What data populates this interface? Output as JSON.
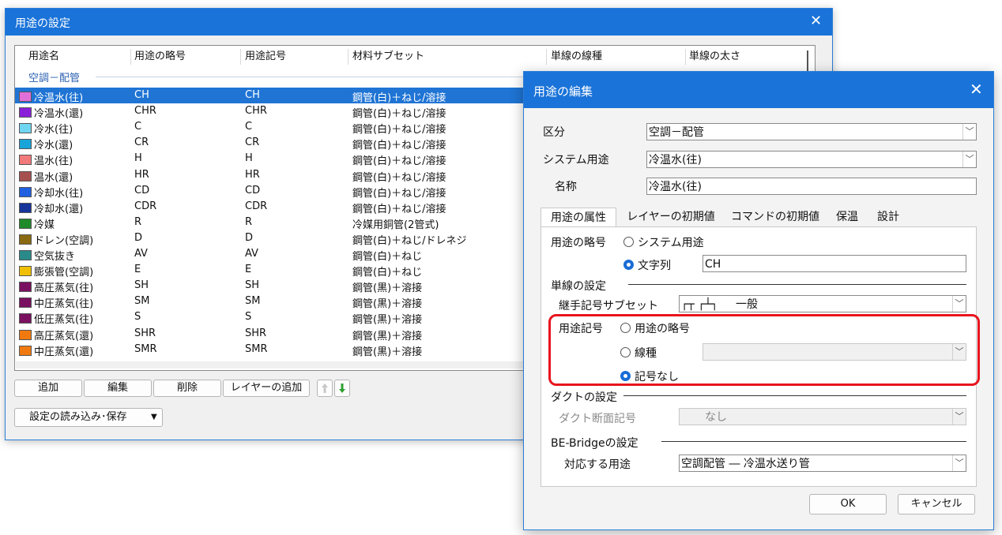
{
  "main_window": {
    "title": "用途の設定",
    "columns": [
      "用途名",
      "用途の略号",
      "用途記号",
      "材料サブセット",
      "単線の線種",
      "単線の太さ"
    ],
    "group_label": "空調－配管",
    "rows": [
      {
        "name": "冷温水(往)",
        "abbr": "CH",
        "symbol": "CH",
        "material": "鋼管(白)＋ねじ/溶接",
        "color": "#e070d8",
        "selected": true
      },
      {
        "name": "冷温水(還)",
        "abbr": "CHR",
        "symbol": "CHR",
        "material": "鋼管(白)＋ねじ/溶接",
        "color": "#8a1fd8"
      },
      {
        "name": "冷水(往)",
        "abbr": "C",
        "symbol": "C",
        "material": "鋼管(白)＋ねじ/溶接",
        "color": "#6fd6f2"
      },
      {
        "name": "冷水(還)",
        "abbr": "CR",
        "symbol": "CR",
        "material": "鋼管(白)＋ねじ/溶接",
        "color": "#18a4d8"
      },
      {
        "name": "温水(往)",
        "abbr": "H",
        "symbol": "H",
        "material": "鋼管(白)＋ねじ/溶接",
        "color": "#f27a7a"
      },
      {
        "name": "温水(還)",
        "abbr": "HR",
        "symbol": "HR",
        "material": "鋼管(白)＋ねじ/溶接",
        "color": "#a65050"
      },
      {
        "name": "冷却水(往)",
        "abbr": "CD",
        "symbol": "CD",
        "material": "鋼管(白)＋ねじ/溶接",
        "color": "#1f5fe0"
      },
      {
        "name": "冷却水(還)",
        "abbr": "CDR",
        "symbol": "CDR",
        "material": "鋼管(白)＋ねじ/溶接",
        "color": "#16349a"
      },
      {
        "name": "冷媒",
        "abbr": "R",
        "symbol": "R",
        "material": "冷媒用銅管(2管式)",
        "color": "#1f8a2a"
      },
      {
        "name": "ドレン(空調)",
        "abbr": "D",
        "symbol": "D",
        "material": "鋼管(白)＋ねじ/ドレネジ",
        "color": "#8a6a10"
      },
      {
        "name": "空気抜き",
        "abbr": "AV",
        "symbol": "AV",
        "material": "鋼管(白)＋ねじ",
        "color": "#2a8a8a"
      },
      {
        "name": "膨張管(空調)",
        "abbr": "E",
        "symbol": "E",
        "material": "鋼管(白)＋ねじ",
        "color": "#f0c000"
      },
      {
        "name": "高圧蒸気(往)",
        "abbr": "SH",
        "symbol": "SH",
        "material": "鋼管(黒)＋溶接",
        "color": "#7a1060"
      },
      {
        "name": "中圧蒸気(往)",
        "abbr": "SM",
        "symbol": "SM",
        "material": "鋼管(黒)＋溶接",
        "color": "#7a1060"
      },
      {
        "name": "低圧蒸気(往)",
        "abbr": "S",
        "symbol": "S",
        "material": "鋼管(黒)＋溶接",
        "color": "#7a1060"
      },
      {
        "name": "高圧蒸気(還)",
        "abbr": "SHR",
        "symbol": "SHR",
        "material": "鋼管(黒)＋溶接",
        "color": "#f07a10"
      },
      {
        "name": "中圧蒸気(還)",
        "abbr": "SMR",
        "symbol": "SMR",
        "material": "鋼管(黒)＋溶接",
        "color": "#f07a10"
      }
    ],
    "buttons": {
      "add": "追加",
      "edit": "編集",
      "delete": "削除",
      "add_layer": "レイヤーの追加",
      "load_save": "設定の読み込み･保存"
    }
  },
  "edit_dialog": {
    "title": "用途の編集",
    "category_label": "区分",
    "category_value": "空調－配管",
    "system_use_label": "システム用途",
    "system_use_value": "冷温水(往)",
    "name_label": "名称",
    "name_value": "冷温水(往)",
    "tabs": [
      "用途の属性",
      "レイヤーの初期値",
      "コマンドの初期値",
      "保温",
      "設計"
    ],
    "abbr_label": "用途の略号",
    "abbr_opt_system": "システム用途",
    "abbr_opt_string": "文字列",
    "abbr_string_value": "CH",
    "single_line_section": "単線の設定",
    "joint_symbol_label": "継手記号サブセット",
    "joint_symbol_glyph": "┌┬ ┌┴┐",
    "joint_symbol_value": "一般",
    "use_symbol_label": "用途記号",
    "use_symbol_opt_abbr": "用途の略号",
    "use_symbol_opt_linetype": "線種",
    "use_symbol_opt_none": "記号なし",
    "duct_section": "ダクトの設定",
    "duct_section_symbol_label": "ダクト断面記号",
    "duct_section_symbol_value": "なし",
    "bebridge_section": "BE-Bridgeの設定",
    "corresponding_use_label": "対応する用途",
    "corresponding_use_value": "空調配管 ― 冷温水送り管",
    "ok": "OK",
    "cancel": "キャンセル"
  }
}
